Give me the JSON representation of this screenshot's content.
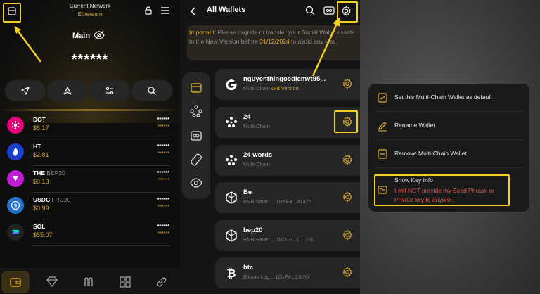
{
  "panel1": {
    "network_label": "Current Network",
    "network_value": "Ethereum",
    "wallet_name": "Main",
    "balance": "******",
    "coins": [
      {
        "symbol": "DOT",
        "tag": "",
        "price": "$5.17",
        "bal1": "******",
        "bal2": "******",
        "color": "#e6007a"
      },
      {
        "symbol": "HT",
        "tag": "",
        "price": "$2.81",
        "bal1": "******",
        "bal2": "******",
        "color": "#1a3fd1"
      },
      {
        "symbol": "THE",
        "tag": "BEP20",
        "price": "$0.13",
        "bal1": "******",
        "bal2": "******",
        "color": "#c11dd6"
      },
      {
        "symbol": "USDC",
        "tag": "FRC20",
        "price": "$0.99",
        "bal1": "******",
        "bal2": "******",
        "color": "#2775ca"
      },
      {
        "symbol": "SOL",
        "tag": "",
        "price": "$55.07",
        "bal1": "******",
        "bal2": "******",
        "color": "#222"
      }
    ]
  },
  "panel2": {
    "title": "All Wallets",
    "notice_prefix": "Important:",
    "notice_text1": " Please migrate or transfer your Social Wallet assets to the New Version before ",
    "notice_date": "31/12/2024",
    "notice_text2": " to avoid any loss.",
    "wallets": [
      {
        "name": "nguyenthingocdiemvt95...",
        "sub": "Multi-Chain",
        "badge": "Old Version",
        "icon": "google-icon"
      },
      {
        "name": "24",
        "sub": "Multi-Chain",
        "badge": "",
        "icon": "multichain-icon"
      },
      {
        "name": "24 words",
        "sub": "Multi-Chain",
        "badge": "",
        "icon": "multichain-icon"
      },
      {
        "name": "Be",
        "sub": "BNB Smart ...    0xBE4...41a7d",
        "badge": "",
        "icon": "bnb-icon"
      },
      {
        "name": "bep20",
        "sub": "BNB Smart ...    0xD10...C1D76",
        "badge": "",
        "icon": "bnb-icon"
      },
      {
        "name": "btc",
        "sub": "Bitcoin Leg...    1GzF4...L5rKY",
        "badge": "",
        "icon": "bitcoin-icon"
      }
    ]
  },
  "panel3": {
    "items": [
      {
        "label": "Set this Multi-Chain Wallet as default"
      },
      {
        "label": "Rename Wallet"
      },
      {
        "label": "Remove Multi-Chain Wallet"
      },
      {
        "label": "Show Key Info"
      }
    ],
    "warning": "I will NOT provide my Seed Phrase or Private key to anyone."
  },
  "colors": {
    "accent": "#d9a72c",
    "highlight": "#f5d020",
    "warning": "#e05a4f"
  }
}
